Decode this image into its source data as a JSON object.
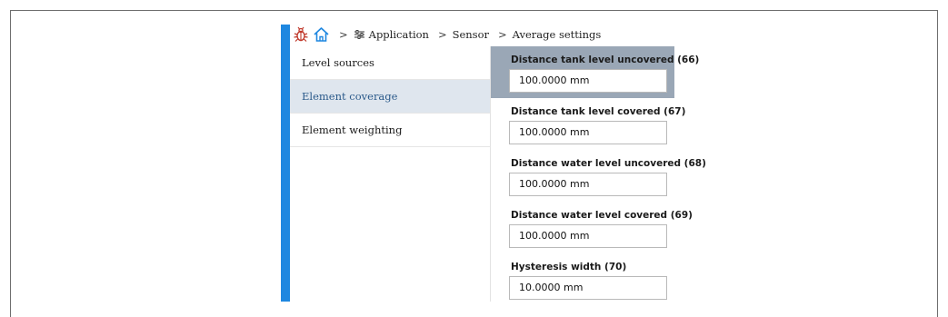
{
  "breadcrumb": {
    "icons": [
      "bug-icon",
      "home-icon",
      "sliders-icon"
    ],
    "separator": ">",
    "items": [
      "Application",
      "Sensor",
      "Average settings"
    ]
  },
  "nav": {
    "items": [
      {
        "label": "Level sources",
        "active": false
      },
      {
        "label": "Element coverage",
        "active": true
      },
      {
        "label": "Element weighting",
        "active": false
      }
    ]
  },
  "fields": [
    {
      "label": "Distance tank level uncovered (66)",
      "value": "100.0000 mm",
      "selected": true
    },
    {
      "label": "Distance tank level covered (67)",
      "value": "100.0000 mm",
      "selected": false
    },
    {
      "label": "Distance water level uncovered (68)",
      "value": "100.0000 mm",
      "selected": false
    },
    {
      "label": "Distance water level covered (69)",
      "value": "100.0000 mm",
      "selected": false
    },
    {
      "label": "Hysteresis width (70)",
      "value": "10.0000 mm",
      "selected": false
    }
  ],
  "colors": {
    "accent": "#1e87e0",
    "bug_icon": "#c0392b",
    "home_icon": "#1e87e0",
    "active_nav_bg": "#dfe6ee",
    "selected_field_bg": "#9aa7b6"
  }
}
